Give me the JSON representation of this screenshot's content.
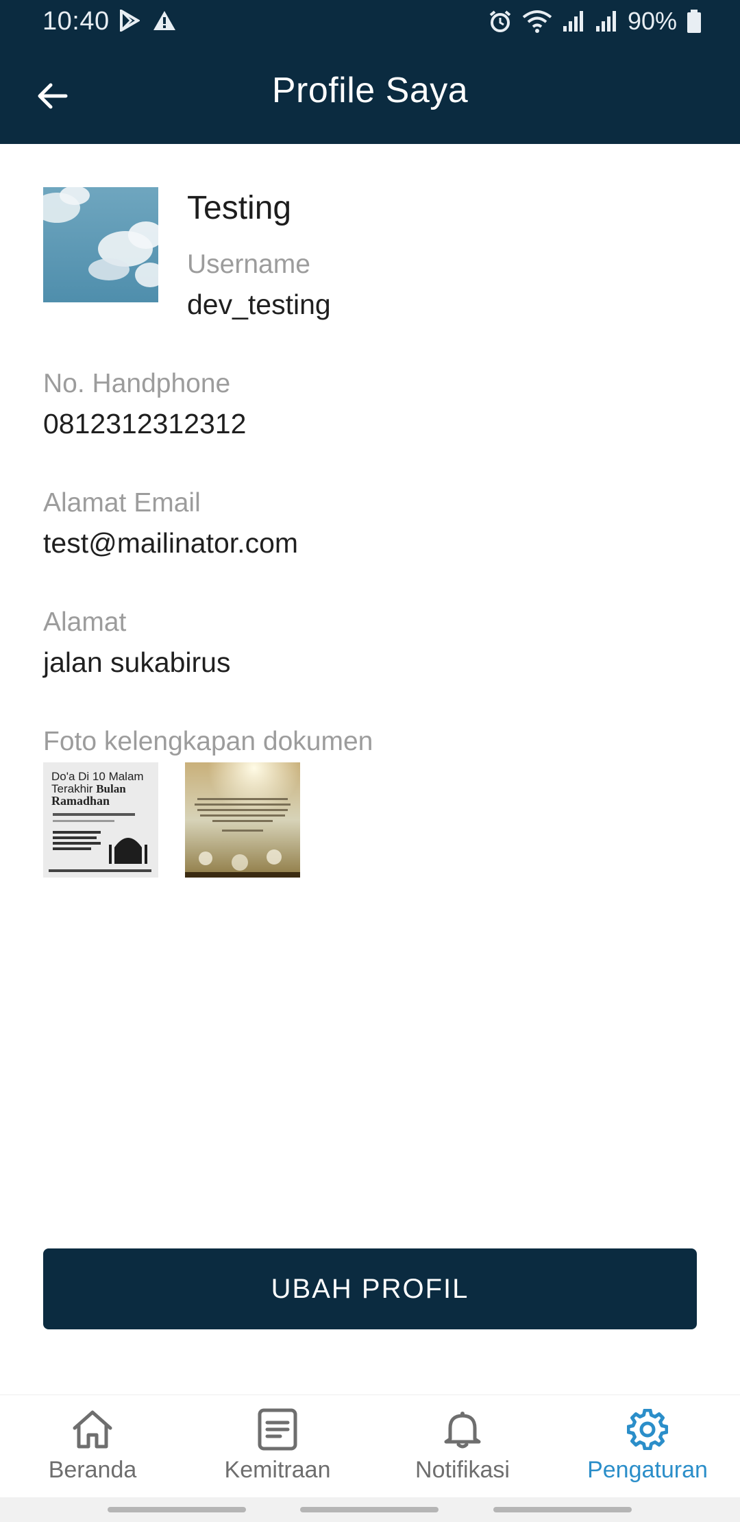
{
  "status_bar": {
    "time": "10:40",
    "battery": "90%",
    "icons": [
      "play-store-icon",
      "warning-icon",
      "alarm-icon",
      "wifi-icon",
      "signal-icon",
      "signal-icon",
      "battery-icon"
    ]
  },
  "header": {
    "title": "Profile Saya",
    "back_icon": "arrow-left-icon"
  },
  "profile": {
    "name": "Testing",
    "username_label": "Username",
    "username": "dev_testing",
    "phone_label": "No. Handphone",
    "phone": "0812312312312",
    "email_label": "Alamat Email",
    "email": "test@mailinator.com",
    "address_label": "Alamat",
    "address": "jalan sukabirus",
    "documents_label": "Foto kelengkapan dokumen"
  },
  "documents": {
    "doc1": {
      "line1": "Do'a Di 10 Malam",
      "line2": "Terakhir",
      "line2_bold": "Bulan",
      "line3": "Ramadhan"
    },
    "doc2": {}
  },
  "actions": {
    "edit_profile": "UBAH PROFIL"
  },
  "bottom_nav": {
    "items": [
      {
        "label": "Beranda",
        "icon": "home-icon",
        "active": false
      },
      {
        "label": "Kemitraan",
        "icon": "document-icon",
        "active": false
      },
      {
        "label": "Notifikasi",
        "icon": "bell-icon",
        "active": false
      },
      {
        "label": "Pengaturan",
        "icon": "gear-icon",
        "active": true
      }
    ]
  },
  "colors": {
    "primary": "#0b2b40",
    "accent": "#2b8ec9",
    "label": "#9c9c9c"
  }
}
